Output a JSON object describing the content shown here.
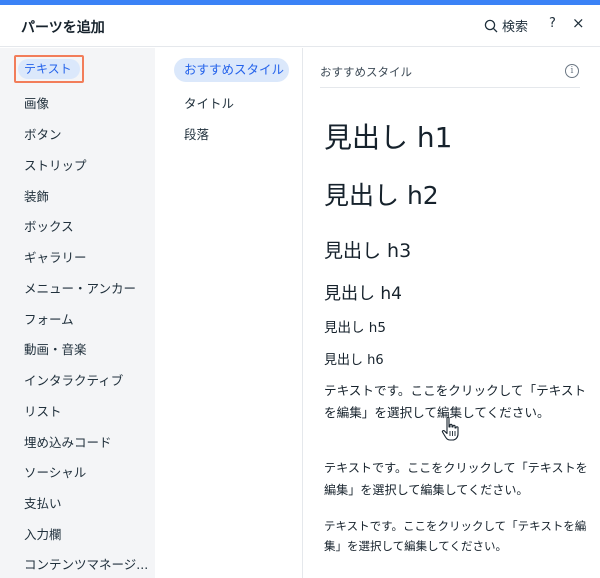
{
  "header": {
    "title": "パーツを追加",
    "search_label": "検索",
    "help_label": "?",
    "close_label": "×"
  },
  "categories": [
    "テキスト",
    "画像",
    "ボタン",
    "ストリップ",
    "装飾",
    "ボックス",
    "ギャラリー",
    "メニュー・アンカー",
    "フォーム",
    "動画・音楽",
    "インタラクティブ",
    "リスト",
    "埋め込みコード",
    "ソーシャル",
    "支払い",
    "入力欄",
    "コンテンツマネージ..."
  ],
  "subcategories": [
    "おすすめスタイル",
    "タイトル",
    "段落"
  ],
  "panel": {
    "section_title": "おすすめスタイル",
    "info_label": "i",
    "headings": [
      "見出し h1",
      "見出し h2",
      "見出し h3",
      "見出し h4",
      "見出し h5",
      "見出し h6"
    ],
    "paragraphs": [
      "テキストです。ここをクリックして「テキストを編集」を選択して編集してください。",
      "テキストです。ここをクリックして「テキストを編集」を選択して編集してください。",
      "テキストです。ここをクリックして「テキストを編集」を選択して編集してください。"
    ]
  },
  "colors": {
    "accent": "#3b82f6",
    "selected_bg": "#dbe8fb",
    "highlight_border": "#f27d5a"
  }
}
